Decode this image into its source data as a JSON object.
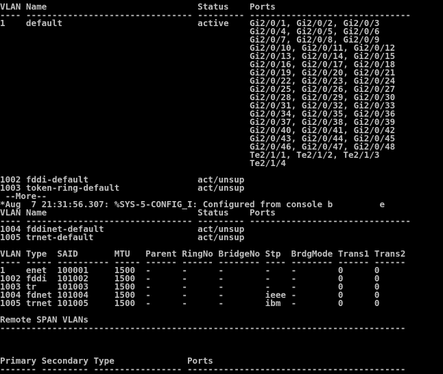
{
  "terminal": {
    "lines": [
      "VLAN Name                             Status    Ports",
      "---- -------------------------------- --------- -------------------------------",
      "1    default                          active    Gi2/0/1, Gi2/0/2, Gi2/0/3",
      "                                                Gi2/0/4, Gi2/0/5, Gi2/0/6",
      "                                                Gi2/0/7, Gi2/0/8, Gi2/0/9",
      "                                                Gi2/0/10, Gi2/0/11, Gi2/0/12",
      "                                                Gi2/0/13, Gi2/0/14, Gi2/0/15",
      "                                                Gi2/0/16, Gi2/0/17, Gi2/0/18",
      "                                                Gi2/0/19, Gi2/0/20, Gi2/0/21",
      "                                                Gi2/0/22, Gi2/0/23, Gi2/0/24",
      "                                                Gi2/0/25, Gi2/0/26, Gi2/0/27",
      "                                                Gi2/0/28, Gi2/0/29, Gi2/0/30",
      "                                                Gi2/0/31, Gi2/0/32, Gi2/0/33",
      "                                                Gi2/0/34, Gi2/0/35, Gi2/0/36",
      "                                                Gi2/0/37, Gi2/0/38, Gi2/0/39",
      "                                                Gi2/0/40, Gi2/0/41, Gi2/0/42",
      "                                                Gi2/0/43, Gi2/0/44, Gi2/0/45",
      "                                                Gi2/0/46, Gi2/0/47, Gi2/0/48",
      "                                                Te2/1/1, Te2/1/2, Te2/1/3",
      "                                                Te2/1/4",
      "",
      "1002 fddi-default                     act/unsup",
      "1003 token-ring-default               act/unsup",
      " --More--",
      "*Aug  7 21:31:56.307: %SYS-5-CONFIG_I: Configured from console b         e",
      "VLAN Name                             Status    Ports",
      "---- -------------------------------- --------- -------------------------------",
      "1004 fddinet-default                  act/unsup",
      "1005 trnet-default                    act/unsup",
      "",
      "VLAN Type  SAID       MTU   Parent RingNo BridgeNo Stp  BrdgMode Trans1 Trans2",
      "---- ----- ---------- ----- ------ ------ -------- ---- -------- ------ ------",
      "1    enet  100001     1500  -      -      -        -    -        0      0",
      "1002 fddi  101002     1500  -      -      -        -    -        0      0",
      "1003 tr    101003     1500  -      -      -        -    -        0      0",
      "1004 fdnet 101004     1500  -      -      -        ieee -        0      0",
      "1005 trnet 101005     1500  -      -      -        ibm  -        0      0",
      "",
      "Remote SPAN VLANs",
      "------------------------------------------------------------------------------",
      "",
      "",
      "",
      "Primary Secondary Type              Ports",
      "------- --------- ----------------- ------------------------------------------"
    ]
  }
}
